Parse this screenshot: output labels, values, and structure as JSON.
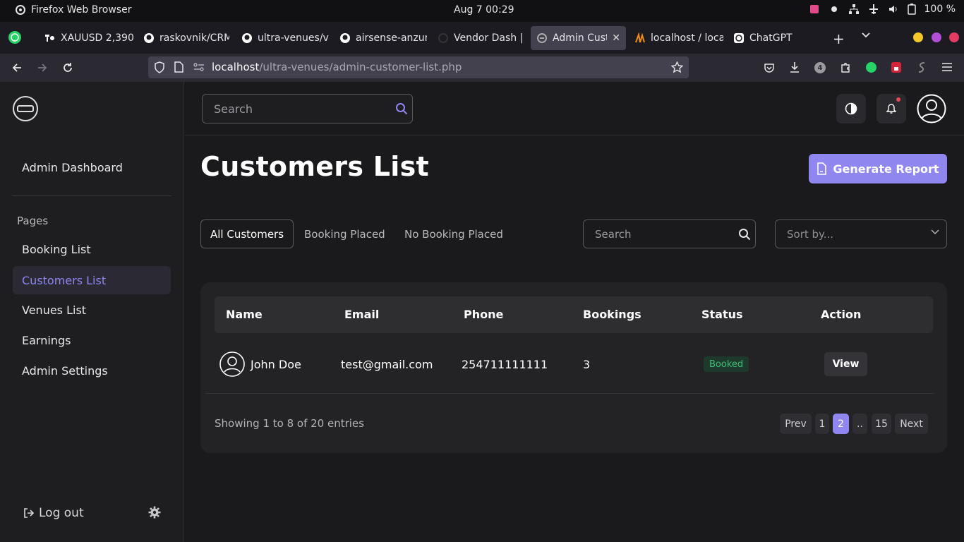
{
  "os": {
    "app_name": "Firefox Web Browser",
    "clock": "Aug 7  00:29",
    "battery": "100 %"
  },
  "tabs": [
    {
      "label": "XAUUSD 2,390",
      "icon": "tradingview-icon"
    },
    {
      "label": "raskovnik/CRM",
      "icon": "github-icon"
    },
    {
      "label": "ultra-venues/v",
      "icon": "github-icon"
    },
    {
      "label": "airsense-anzur",
      "icon": "github-icon"
    },
    {
      "label": "Vendor Dash |",
      "icon": "site-icon"
    },
    {
      "label": "Admin Custo",
      "icon": "site-icon"
    },
    {
      "label": "localhost / loca",
      "icon": "phpmyadmin-icon"
    },
    {
      "label": "ChatGPT",
      "icon": "chatgpt-icon"
    }
  ],
  "url": {
    "host": "localhost",
    "path": "/ultra-venues/admin-customer-list.php"
  },
  "extensions": {
    "badge_count": "4"
  },
  "sidebar": {
    "dashboard": "Admin Dashboard",
    "section": "Pages",
    "items": [
      "Booking List",
      "Customers List",
      "Venues List",
      "Earnings",
      "Admin Settings"
    ],
    "active_index": 1,
    "logout": "Log out"
  },
  "topbar": {
    "search_placeholder": "Search"
  },
  "main": {
    "title": "Customers List",
    "generate_report": "Generate Report",
    "filters": [
      "All Customers",
      "Booking Placed",
      "No Booking Placed"
    ],
    "table_search_placeholder": "Search",
    "sort_placeholder": "Sort by..."
  },
  "table": {
    "columns": [
      "Name",
      "Email",
      "Phone",
      "Bookings",
      "Status",
      "Action"
    ],
    "rows": [
      {
        "name": "John Doe",
        "email": "test@gmail.com",
        "phone": "254711111111",
        "bookings": "3",
        "status": "Booked",
        "action": "View"
      }
    ],
    "entries": "Showing 1 to 8 of 20 entries"
  },
  "pagination": {
    "prev": "Prev",
    "pages": [
      "1",
      "2",
      "..",
      "15"
    ],
    "active_page": "2",
    "next": "Next"
  },
  "colors": {
    "accent": "#8f86f0",
    "status_green": "#3fbf79"
  }
}
